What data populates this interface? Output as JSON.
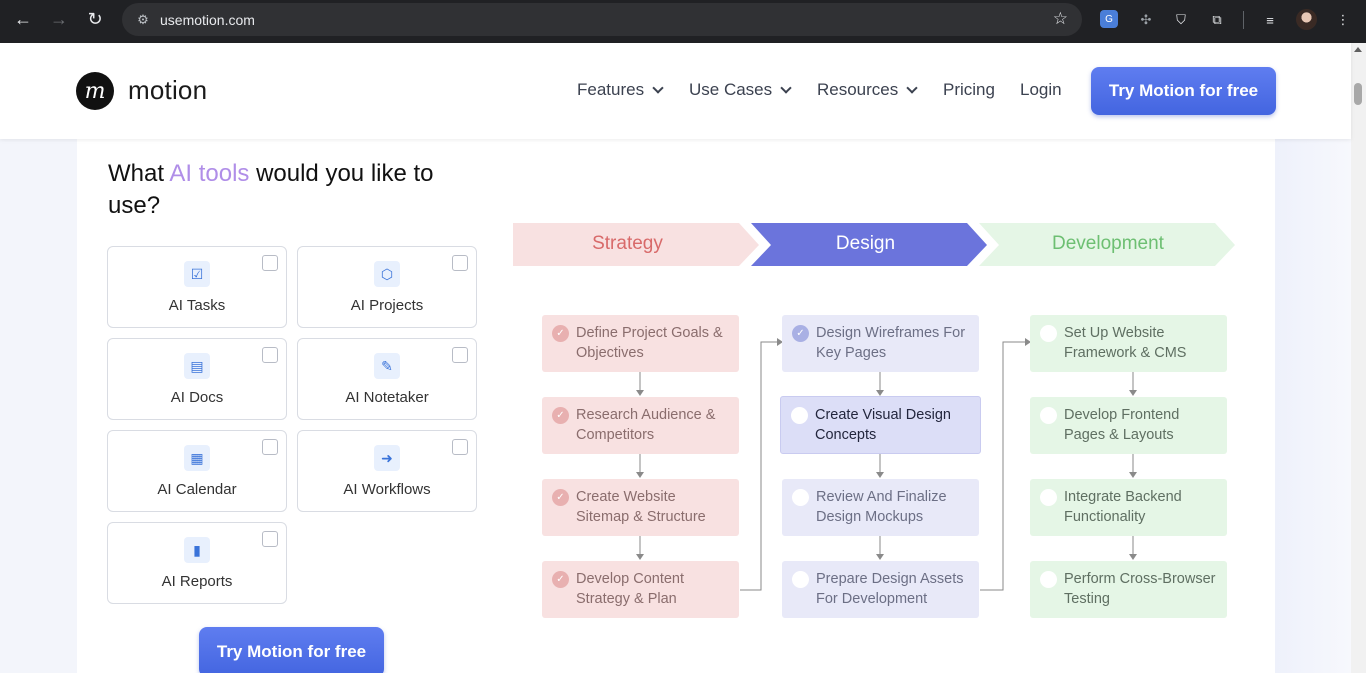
{
  "browser": {
    "url": "usemotion.com"
  },
  "header": {
    "logo_text": "motion",
    "nav": [
      {
        "label": "Features",
        "dropdown": true
      },
      {
        "label": "Use Cases",
        "dropdown": true
      },
      {
        "label": "Resources",
        "dropdown": true
      },
      {
        "label": "Pricing",
        "dropdown": false
      },
      {
        "label": "Login",
        "dropdown": false
      }
    ],
    "cta_label": "Try Motion for free"
  },
  "question": {
    "prefix": "What ",
    "accent": "AI tools",
    "suffix": " would you like to use?"
  },
  "tools": [
    {
      "label": "AI Tasks",
      "icon": "checklist-icon",
      "glyph": "☑"
    },
    {
      "label": "AI Projects",
      "icon": "cube-icon",
      "glyph": "⬡"
    },
    {
      "label": "AI Docs",
      "icon": "document-icon",
      "glyph": "▤"
    },
    {
      "label": "AI Notetaker",
      "icon": "pen-sparkle-icon",
      "glyph": "✎"
    },
    {
      "label": "AI Calendar",
      "icon": "calendar-icon",
      "glyph": "▦"
    },
    {
      "label": "AI Workflows",
      "icon": "arrow-circle-icon",
      "glyph": "➜"
    },
    {
      "label": "AI Reports",
      "icon": "bar-chart-icon",
      "glyph": "▮"
    }
  ],
  "cta_bottom_label": "Try Motion for free",
  "phases": [
    {
      "label": "Strategy",
      "color": "#f8e1e1",
      "text_color": "#d86a6a"
    },
    {
      "label": "Design",
      "color": "#6b74dc",
      "text_color": "#ffffff"
    },
    {
      "label": "Development",
      "color": "#e5f6e6",
      "text_color": "#6dbf72"
    }
  ],
  "columns": [
    {
      "theme": "red",
      "tasks": [
        {
          "label": "Define Project Goals & Objectives",
          "done": true
        },
        {
          "label": "Research Audience & Competitors",
          "done": true
        },
        {
          "label": "Create Website Sitemap & Structure",
          "done": true
        },
        {
          "label": "Develop Content Strategy & Plan",
          "done": true
        }
      ]
    },
    {
      "theme": "blue",
      "tasks": [
        {
          "label": "Design Wireframes For Key Pages",
          "done": true
        },
        {
          "label": "Create Visual Design Concepts",
          "done": false,
          "active": true
        },
        {
          "label": "Review And Finalize Design Mockups",
          "done": false
        },
        {
          "label": "Prepare Design Assets For Development",
          "done": false
        }
      ]
    },
    {
      "theme": "green",
      "tasks": [
        {
          "label": "Set Up Website Framework & CMS",
          "done": false
        },
        {
          "label": "Develop Frontend Pages & Layouts",
          "done": false
        },
        {
          "label": "Integrate Backend Functionality",
          "done": false
        },
        {
          "label": "Perform Cross-Browser Testing",
          "done": false
        }
      ]
    }
  ]
}
